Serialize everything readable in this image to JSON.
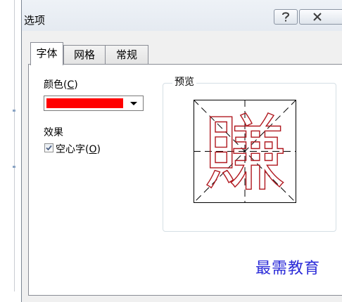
{
  "window": {
    "title": "选项"
  },
  "titlebar_buttons": {
    "help_glyph": "?",
    "close_glyph": "⊠"
  },
  "tabs": [
    {
      "label": "字体",
      "active": true
    },
    {
      "label": "网格",
      "active": false
    },
    {
      "label": "常规",
      "active": false
    }
  ],
  "font_tab": {
    "color_label_text": "颜色(",
    "color_label_key": "C",
    "color_label_end": ")",
    "color_value": "#ff0000",
    "effects_label": "效果",
    "outline_checkbox": {
      "text": "空心字(",
      "key": "O",
      "end": ")",
      "checked": true
    },
    "preview_label": "预览",
    "preview_glyph": "賺"
  },
  "colors": {
    "swatch_red": "#ff0000",
    "glyph_outline": "#b0181f",
    "watermark_blue": "#2b2bd8"
  },
  "watermark": "最需教育",
  "icons": {
    "help": "help-icon",
    "close": "close-icon",
    "dropdown": "chevron-down-icon",
    "check": "check-icon"
  }
}
